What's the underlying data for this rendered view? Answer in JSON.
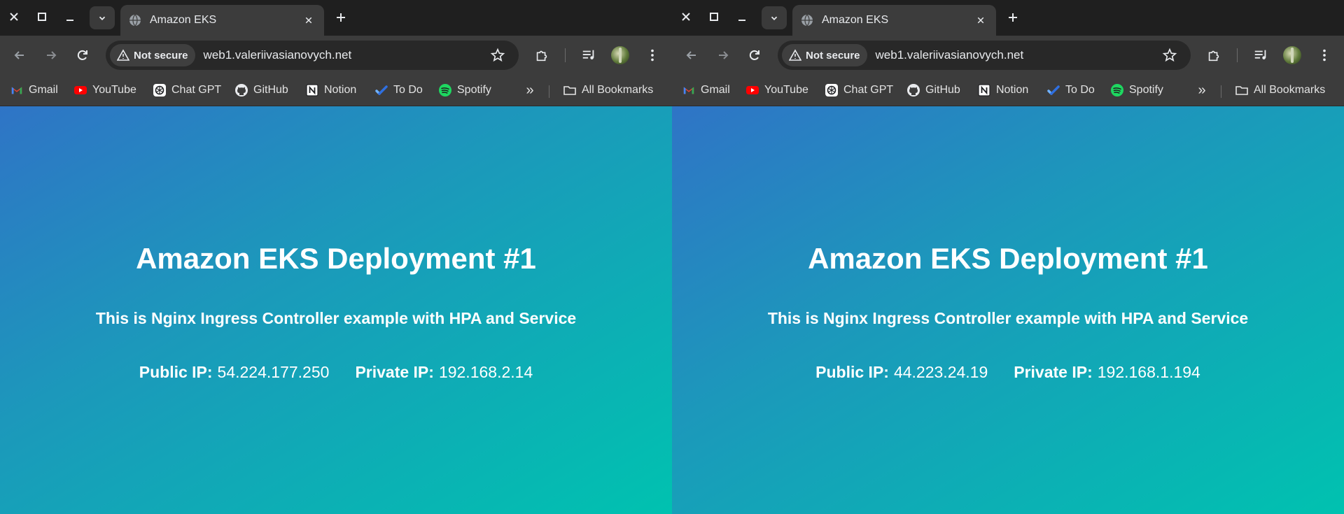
{
  "windows": [
    {
      "tab": {
        "title": "Amazon EKS"
      },
      "omnibox": {
        "security_label": "Not secure",
        "url": "web1.valeriivasianovych.net"
      },
      "bookmarks": [
        {
          "label": "Gmail",
          "icon": "gmail-icon"
        },
        {
          "label": "YouTube",
          "icon": "youtube-icon"
        },
        {
          "label": "Chat GPT",
          "icon": "chatgpt-icon"
        },
        {
          "label": "GitHub",
          "icon": "github-icon"
        },
        {
          "label": "Notion",
          "icon": "notion-icon"
        },
        {
          "label": "To Do",
          "icon": "todo-icon"
        },
        {
          "label": "Spotify",
          "icon": "spotify-icon"
        }
      ],
      "all_bookmarks_label": "All Bookmarks",
      "page": {
        "title": "Amazon EKS Deployment #1",
        "subtitle": "This is Nginx Ingress Controller example with HPA and Service",
        "public_ip_label": "Public IP:",
        "public_ip": "54.224.177.250",
        "private_ip_label": "Private IP:",
        "private_ip": "192.168.2.14"
      }
    },
    {
      "tab": {
        "title": "Amazon EKS"
      },
      "omnibox": {
        "security_label": "Not secure",
        "url": "web1.valeriivasianovych.net"
      },
      "bookmarks": [
        {
          "label": "Gmail",
          "icon": "gmail-icon"
        },
        {
          "label": "YouTube",
          "icon": "youtube-icon"
        },
        {
          "label": "Chat GPT",
          "icon": "chatgpt-icon"
        },
        {
          "label": "GitHub",
          "icon": "github-icon"
        },
        {
          "label": "Notion",
          "icon": "notion-icon"
        },
        {
          "label": "To Do",
          "icon": "todo-icon"
        },
        {
          "label": "Spotify",
          "icon": "spotify-icon"
        }
      ],
      "all_bookmarks_label": "All Bookmarks",
      "page": {
        "title": "Amazon EKS Deployment #1",
        "subtitle": "This is Nginx Ingress Controller example with HPA and Service",
        "public_ip_label": "Public IP:",
        "public_ip": "44.223.24.19",
        "private_ip_label": "Private IP:",
        "private_ip": "192.168.1.194"
      }
    }
  ],
  "colors": {
    "page_gradient_start": "#2f74c6",
    "page_gradient_end": "#00c2b0",
    "chrome_toolbar": "#3c3c3c",
    "chrome_tabstrip": "#1f1f1f"
  }
}
